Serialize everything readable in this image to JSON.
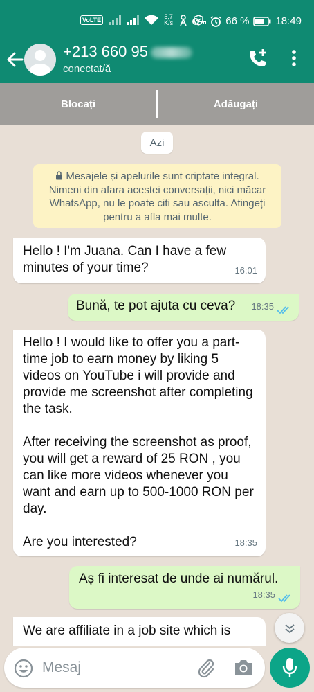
{
  "status_bar": {
    "volte": "VoLTE",
    "speed_value": "5,7",
    "speed_unit": "K/s",
    "battery": "66 %",
    "time": "18:49"
  },
  "contact": {
    "phone": "+213 660 95",
    "presence": "conectat/ă"
  },
  "actions": {
    "block": "Blocați",
    "add": "Adăugați"
  },
  "chat": {
    "date_chip": "Azi",
    "encryption_notice": "Mesajele și apelurile sunt criptate integral. Nimeni din afara acestei conversații, nici măcar WhatsApp, nu le poate citi sau asculta. Atingeți pentru a afla mai multe.",
    "messages": [
      {
        "direction": "in",
        "text": "Hello ! I'm Juana. Can I have a few minutes of your time?",
        "time": "16:01"
      },
      {
        "direction": "out",
        "text": "Bună, te pot ajuta cu ceva?",
        "time": "18:35",
        "status": "read"
      },
      {
        "direction": "in",
        "text": "Hello ! I would like to offer you a part-time job to earn money by liking 5 videos on YouTube i will provide and provide me screenshot after completing the task.\n\nAfter receiving the screenshot as proof, you will get a reward of 25 RON , you can like more videos whenever you want and earn up to 500-1000 RON per day.\n\nAre you interested?",
        "time": "18:35"
      },
      {
        "direction": "out",
        "text": "Aș fi interesat de unde ai numărul.",
        "time": "18:35",
        "status": "read"
      },
      {
        "direction": "in",
        "text": "We are affiliate in a job site which is",
        "time": ""
      }
    ]
  },
  "composer": {
    "placeholder": "Mesaj"
  },
  "colors": {
    "header": "#0f8a72",
    "action_bar": "#9f9d9a",
    "chat_bg": "#e8dfd6",
    "outgoing_bubble": "#dcf8c6",
    "notice_bg": "#fdf3c5",
    "read_ticks": "#53bdeb",
    "mic_button": "#0ca588"
  },
  "icons": [
    "back-arrow-icon",
    "avatar-icon",
    "add-call-icon",
    "more-vert-icon",
    "lock-icon",
    "double-check-icon",
    "chevron-down-icon",
    "emoji-icon",
    "attach-icon",
    "camera-icon",
    "mic-icon"
  ]
}
